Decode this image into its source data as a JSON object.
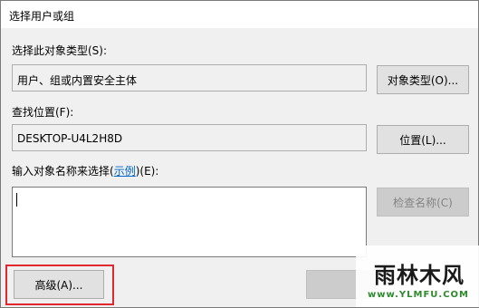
{
  "window": {
    "title": "选择用户或组"
  },
  "object_types": {
    "label": "选择此对象类型(S):",
    "value": "用户、组或内置安全主体",
    "button_label": "对象类型(O)..."
  },
  "location": {
    "label": "查找位置(F):",
    "value": "DESKTOP-U4L2H8D",
    "button_label": "位置(L)..."
  },
  "object_names": {
    "label_before": "输入对象名称来选择(",
    "link_text": "示例",
    "label_after": ")(E):",
    "value": "",
    "check_names_label": "检查名称(C)"
  },
  "footer": {
    "advanced_label": "高级(A)..."
  },
  "watermark": {
    "logo_text": "雨林木风",
    "url_text": "www.YLMFU.COM"
  },
  "colors": {
    "highlight": "#e0282e",
    "link": "#0066cc",
    "watermark_url": "#2d8a2d"
  }
}
